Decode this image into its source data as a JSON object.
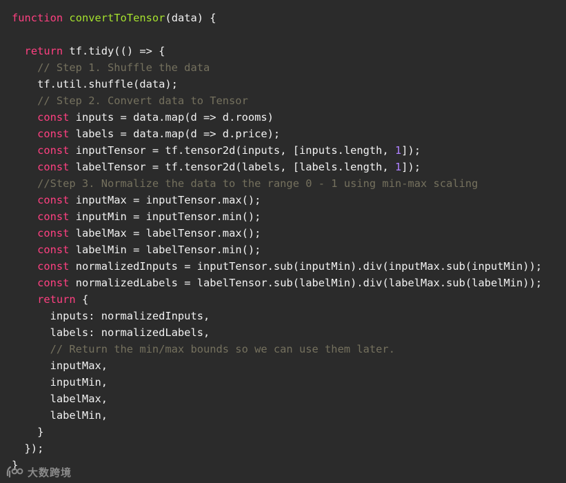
{
  "editor": {
    "background": "#2b2b2b",
    "colors": {
      "keyword": "#ff4081",
      "function": "#a6e22e",
      "comment": "#75715e",
      "number": "#ae81ff",
      "text": "#f2f2f2"
    },
    "lines": [
      [
        {
          "t": "kw",
          "v": "function"
        },
        {
          "t": "",
          "v": " "
        },
        {
          "t": "fn",
          "v": "convertToTensor"
        },
        {
          "t": "",
          "v": "(data) {"
        }
      ],
      [],
      [
        {
          "t": "",
          "v": "  "
        },
        {
          "t": "kw",
          "v": "return"
        },
        {
          "t": "",
          "v": " tf.tidy(() => {"
        }
      ],
      [
        {
          "t": "cm",
          "v": "    // Step 1. Shuffle the data"
        }
      ],
      [
        {
          "t": "",
          "v": "    tf.util.shuffle(data);"
        }
      ],
      [
        {
          "t": "cm",
          "v": "    // Step 2. Convert data to Tensor"
        }
      ],
      [
        {
          "t": "",
          "v": "    "
        },
        {
          "t": "kw",
          "v": "const"
        },
        {
          "t": "",
          "v": " inputs = data.map(d => d.rooms)"
        }
      ],
      [
        {
          "t": "",
          "v": "    "
        },
        {
          "t": "kw",
          "v": "const"
        },
        {
          "t": "",
          "v": " labels = data.map(d => d.price);"
        }
      ],
      [
        {
          "t": "",
          "v": "    "
        },
        {
          "t": "kw",
          "v": "const"
        },
        {
          "t": "",
          "v": " inputTensor = tf.tensor2d(inputs, [inputs.length, "
        },
        {
          "t": "num",
          "v": "1"
        },
        {
          "t": "",
          "v": "]);"
        }
      ],
      [
        {
          "t": "",
          "v": "    "
        },
        {
          "t": "kw",
          "v": "const"
        },
        {
          "t": "",
          "v": " labelTensor = tf.tensor2d(labels, [labels.length, "
        },
        {
          "t": "num",
          "v": "1"
        },
        {
          "t": "",
          "v": "]);"
        }
      ],
      [
        {
          "t": "cm",
          "v": "    //Step 3. Normalize the data to the range 0 - 1 using min-max scaling"
        }
      ],
      [
        {
          "t": "",
          "v": "    "
        },
        {
          "t": "kw",
          "v": "const"
        },
        {
          "t": "",
          "v": " inputMax = inputTensor.max();"
        }
      ],
      [
        {
          "t": "",
          "v": "    "
        },
        {
          "t": "kw",
          "v": "const"
        },
        {
          "t": "",
          "v": " inputMin = inputTensor.min();"
        }
      ],
      [
        {
          "t": "",
          "v": "    "
        },
        {
          "t": "kw",
          "v": "const"
        },
        {
          "t": "",
          "v": " labelMax = labelTensor.max();"
        }
      ],
      [
        {
          "t": "",
          "v": "    "
        },
        {
          "t": "kw",
          "v": "const"
        },
        {
          "t": "",
          "v": " labelMin = labelTensor.min();"
        }
      ],
      [
        {
          "t": "",
          "v": "    "
        },
        {
          "t": "kw",
          "v": "const"
        },
        {
          "t": "",
          "v": " normalizedInputs = inputTensor.sub(inputMin).div(inputMax.sub(inputMin));"
        }
      ],
      [
        {
          "t": "",
          "v": "    "
        },
        {
          "t": "kw",
          "v": "const"
        },
        {
          "t": "",
          "v": " normalizedLabels = labelTensor.sub(labelMin).div(labelMax.sub(labelMin));"
        }
      ],
      [
        {
          "t": "",
          "v": "    "
        },
        {
          "t": "kw",
          "v": "return"
        },
        {
          "t": "",
          "v": " {"
        }
      ],
      [
        {
          "t": "",
          "v": "      inputs: normalizedInputs,"
        }
      ],
      [
        {
          "t": "",
          "v": "      labels: normalizedLabels,"
        }
      ],
      [
        {
          "t": "cm",
          "v": "      // Return the min/max bounds so we can use them later."
        }
      ],
      [
        {
          "t": "",
          "v": "      inputMax,"
        }
      ],
      [
        {
          "t": "",
          "v": "      inputMin,"
        }
      ],
      [
        {
          "t": "",
          "v": "      labelMax,"
        }
      ],
      [
        {
          "t": "",
          "v": "      labelMin,"
        }
      ],
      [
        {
          "t": "",
          "v": "    }"
        }
      ],
      [
        {
          "t": "",
          "v": "  });"
        }
      ],
      [
        {
          "t": "",
          "v": "}"
        }
      ]
    ]
  },
  "watermark": {
    "text": "大数跨境",
    "icon": "brand-logo-icon",
    "color": "#8a8a8a"
  }
}
